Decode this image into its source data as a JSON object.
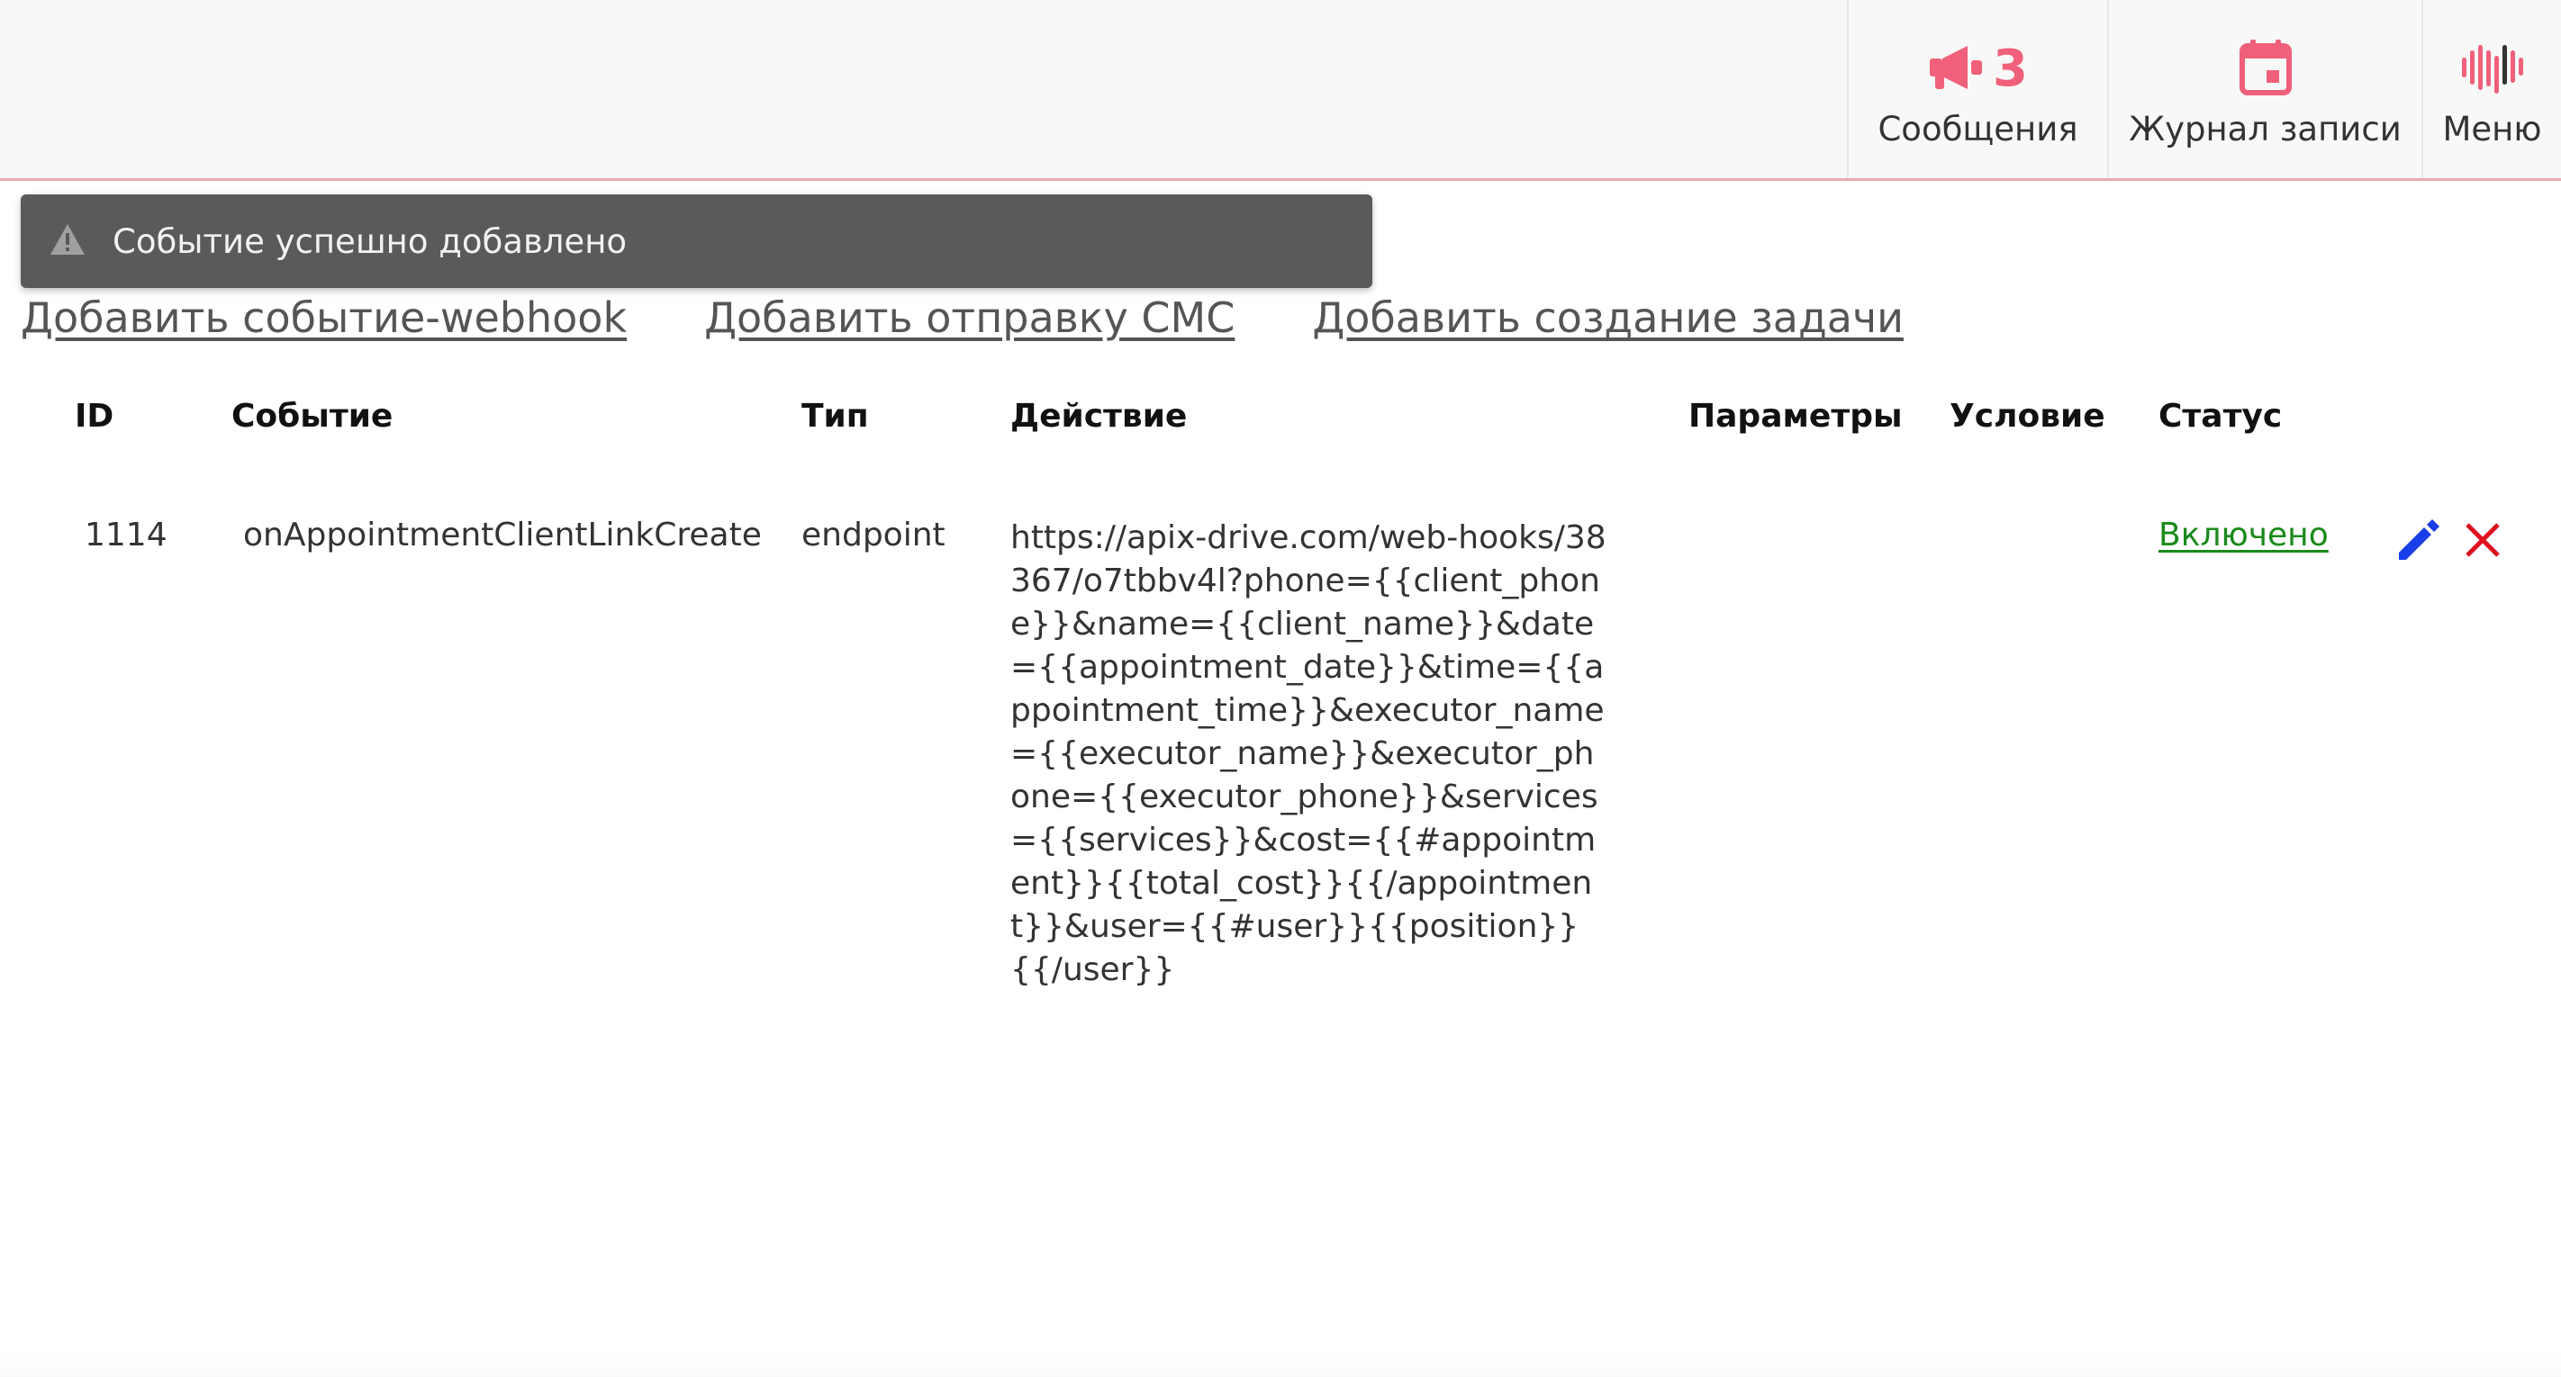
{
  "header": {
    "messages": {
      "label": "Сообщения",
      "count": "3",
      "icon": "megaphone-icon"
    },
    "journal": {
      "label": "Журнал записи",
      "icon": "calendar-icon"
    },
    "menu": {
      "label": "Меню",
      "icon": "logo-bars-icon"
    }
  },
  "toast": {
    "icon": "warning-icon",
    "text": "Событие успешно добавлено"
  },
  "links": {
    "add_webhook": "Добавить событие-webhook",
    "add_sms": "Добавить отправку СМС",
    "add_task": "Добавить создание задачи"
  },
  "table": {
    "headers": {
      "id": "ID",
      "event": "Событие",
      "type": "Тип",
      "action": "Действие",
      "params": "Параметры",
      "condition": "Условие",
      "status": "Статус"
    },
    "rows": [
      {
        "id": "1114",
        "event": "onAppointmentClientLinkCreate",
        "type": "endpoint",
        "action": "https://apix-drive.com/web-hooks/38367/o7tbbv4l?phone={{client_phone}}&name={{client_name}}&date={{appointment_date}}&time={{appointment_time}}&executor_name={{executor_name}}&executor_phone={{executor_phone}}&services={{services}}&cost={{#appointment}}{{total_cost}}{{/appointment}}&user={{#user}}{{position}}{{/user}}",
        "params": "",
        "condition": "",
        "status": "Включено"
      }
    ]
  },
  "colors": {
    "accent": "#f0607a",
    "header_border": "#f0a8b2",
    "toast_bg": "#5a5a5a",
    "status_on": "#1a8a1a",
    "edit_icon": "#1a3ee8",
    "delete_icon": "#e01020"
  }
}
